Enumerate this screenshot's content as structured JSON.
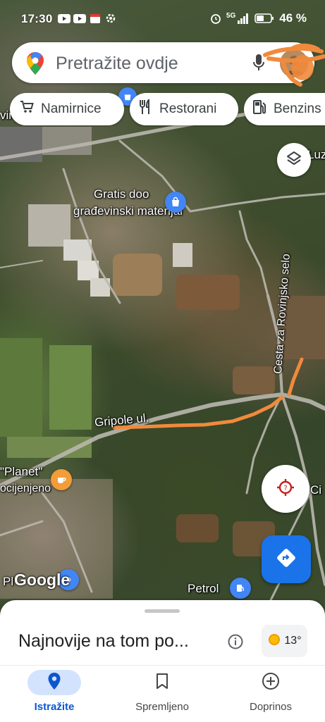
{
  "status_bar": {
    "time": "17:30",
    "battery": "46 %",
    "network": "5G",
    "left_icons": [
      "youtube-icon",
      "youtube-icon",
      "calendar-icon",
      "settings-icon"
    ],
    "right_icons": [
      "alarm-icon",
      "signal-icon",
      "battery-icon"
    ]
  },
  "search": {
    "placeholder": "Pretražite ovdje",
    "icons": [
      "maps-pin-logo-icon",
      "mic-icon",
      "avatar"
    ]
  },
  "chips": [
    {
      "label": "Namirnice",
      "icon": "cart-icon"
    },
    {
      "label": "Restorani",
      "icon": "fork-knife-icon"
    },
    {
      "label": "Benzins",
      "icon": "fuel-pump-icon"
    }
  ],
  "map": {
    "labels": {
      "business_line1": "Gratis doo",
      "business_line2": "građevinski materijal",
      "road_vertical": "Cesta za Rovinjsko selo",
      "road_gripole": "Gripole ul.",
      "planet_line1": "\"Planet\"",
      "planet_line2": "ocijenjeno",
      "petrol": "Petrol",
      "pl": "Pl",
      "luz": "Luz",
      "vinj": "vinj",
      "ci": "Ci"
    },
    "attribution": "Google",
    "annotation_color": "#f08a3c",
    "pin_colors": {
      "shopping": "#4285f4",
      "cafe": "#f29d38",
      "fuel": "#4285f4"
    }
  },
  "controls": {
    "layers": "layers-icon",
    "location": "location-icon",
    "directions": "directions-icon"
  },
  "sheet": {
    "title": "Najnovije na tom po...",
    "temperature": "13°",
    "weather_icon": "sun-icon"
  },
  "nav": [
    {
      "label": "Istražite",
      "icon": "explore-pin-icon",
      "active": true
    },
    {
      "label": "Spremljeno",
      "icon": "bookmark-icon",
      "active": false
    },
    {
      "label": "Doprinos",
      "icon": "add-circle-icon",
      "active": false
    }
  ],
  "colors": {
    "accent": "#1a73e8",
    "active_pill": "#d3e3fd",
    "active_label": "#0b57d0"
  }
}
